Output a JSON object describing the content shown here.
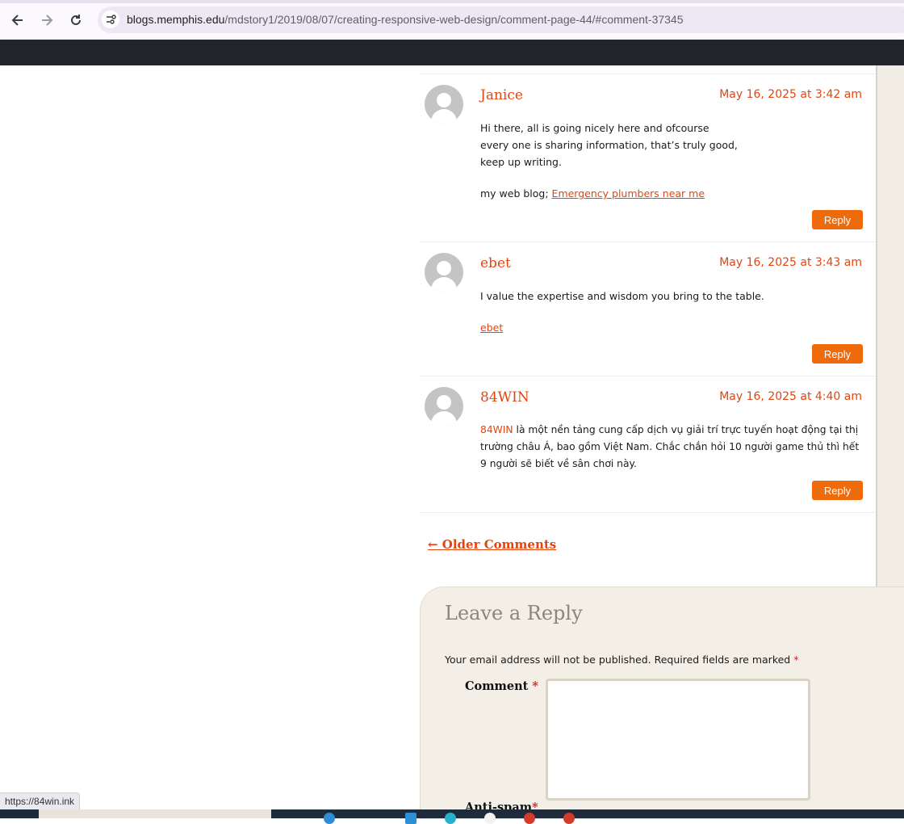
{
  "browser": {
    "url_host": "blogs.memphis.edu",
    "url_path": "/mdstory1/2019/08/07/creating-responsive-web-design/comment-page-44/#comment-37345",
    "status_url": "https://84win.ink"
  },
  "comments": [
    {
      "author": "Janice",
      "date": "May 16, 2025 at 3:42 am",
      "lines": [
        "Hi there, all is going nicely here and ofcourse",
        "every one is sharing information, that’s truly good,",
        "keep up writing."
      ],
      "link_prefix": "my web blog; ",
      "link_text": "Emergency plumbers near me",
      "reply": "Reply"
    },
    {
      "author": "ebet",
      "date": "May 16, 2025 at 3:43 am",
      "text": "I value the expertise and wisdom you bring to the table.",
      "link_text": "ebet",
      "reply": "Reply"
    },
    {
      "author": "84WIN",
      "date": "May 16, 2025 at 4:40 am",
      "inline_link": "84WIN",
      "lines": [
        " là một nền tảng cung cấp dịch vụ giải trí trực tuyến hoạt động tại thị",
        "trường châu Á, bao gồm Việt Nam. Chắc chắn hỏi 10 người game thủ thì hết",
        "9 người sẽ biết về sân chơi này."
      ],
      "reply": "Reply"
    }
  ],
  "pagination": {
    "older": "← Older Comments"
  },
  "respond": {
    "title": "Leave a Reply",
    "notes": "Your email address will not be published. Required fields are marked ",
    "required_mark": "*",
    "comment_label": "Comment ",
    "antispam_label": "Anti-spam"
  },
  "colors": {
    "accent": "#e4450f",
    "reply_button": "#ef6a0a",
    "dark_bar": "#22262a"
  }
}
